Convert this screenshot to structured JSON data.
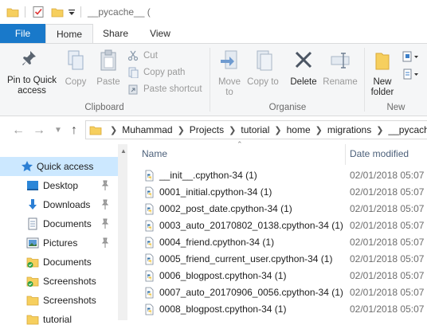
{
  "window": {
    "title": "__pycache__ ("
  },
  "ribbon": {
    "tabs": [
      {
        "label": "File"
      },
      {
        "label": "Home"
      },
      {
        "label": "Share"
      },
      {
        "label": "View"
      }
    ],
    "clipboard": {
      "pin_label": "Pin to Quick access",
      "copy_label": "Copy",
      "paste_label": "Paste",
      "cut_label": "Cut",
      "copy_path_label": "Copy path",
      "paste_shortcut_label": "Paste shortcut",
      "group_label": "Clipboard"
    },
    "organise": {
      "move_label": "Move to",
      "copy_to_label": "Copy to",
      "delete_label": "Delete",
      "rename_label": "Rename",
      "group_label": "Organise"
    },
    "new": {
      "new_folder_label": "New folder",
      "group_label": "New"
    }
  },
  "address": {
    "crumbs": [
      "Muhammad",
      "Projects",
      "tutorial",
      "home",
      "migrations",
      "__pycache__"
    ]
  },
  "nav_pane": {
    "items": [
      {
        "label": "Quick access",
        "icon": "star-icon",
        "pinned": false
      },
      {
        "label": "Desktop",
        "icon": "desktop-icon",
        "pinned": true
      },
      {
        "label": "Downloads",
        "icon": "download-icon",
        "pinned": true
      },
      {
        "label": "Documents",
        "icon": "documents-icon",
        "pinned": true
      },
      {
        "label": "Pictures",
        "icon": "pictures-icon",
        "pinned": true
      },
      {
        "label": "Documents",
        "icon": "synced-folder-icon",
        "pinned": false
      },
      {
        "label": "Screenshots",
        "icon": "synced-folder-icon",
        "pinned": false
      },
      {
        "label": "Screenshots",
        "icon": "folder-icon",
        "pinned": false
      },
      {
        "label": "tutorial",
        "icon": "folder-icon",
        "pinned": false
      }
    ]
  },
  "file_list": {
    "columns": {
      "name": "Name",
      "date": "Date modified"
    },
    "files": [
      {
        "name": "__init__.cpython-34 (1)",
        "date": "02/01/2018 05:07"
      },
      {
        "name": "0001_initial.cpython-34 (1)",
        "date": "02/01/2018 05:07"
      },
      {
        "name": "0002_post_date.cpython-34 (1)",
        "date": "02/01/2018 05:07"
      },
      {
        "name": "0003_auto_20170802_0138.cpython-34 (1)",
        "date": "02/01/2018 05:07"
      },
      {
        "name": "0004_friend.cpython-34 (1)",
        "date": "02/01/2018 05:07"
      },
      {
        "name": "0005_friend_current_user.cpython-34 (1)",
        "date": "02/01/2018 05:07"
      },
      {
        "name": "0006_blogpost.cpython-34 (1)",
        "date": "02/01/2018 05:07"
      },
      {
        "name": "0007_auto_20170906_0056.cpython-34 (1)",
        "date": "02/01/2018 05:07"
      },
      {
        "name": "0008_blogpost.cpython-34 (1)",
        "date": "02/01/2018 05:07"
      }
    ]
  },
  "colors": {
    "accent": "#1979ca",
    "selection": "#cce8ff",
    "folder": "#f6cf5e"
  }
}
